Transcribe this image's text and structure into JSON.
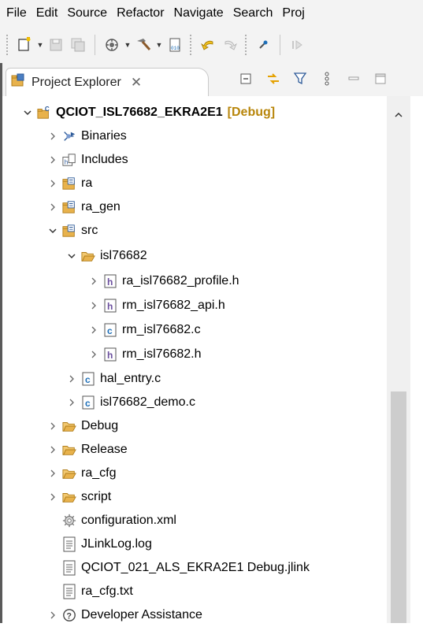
{
  "menubar": {
    "items": [
      "File",
      "Edit",
      "Source",
      "Refactor",
      "Navigate",
      "Search",
      "Proj"
    ]
  },
  "toolbar": {
    "buttons": [
      "new-wizard-icon",
      "save-icon",
      "save-all-icon",
      "debug-config-icon",
      "build-hammer-icon",
      "binary-file-icon",
      "back-arrow-icon",
      "forward-arrow-icon",
      "pin-icon",
      "resume-icon"
    ]
  },
  "view": {
    "title": "Project Explorer",
    "close_glyph": "✕",
    "actions": [
      "collapse-all-icon",
      "link-with-editor-icon",
      "filter-icon",
      "view-menu-icon",
      "minimize-icon",
      "maximize-icon"
    ]
  },
  "tree": {
    "project": {
      "name": "QCIOT_ISL76682_EKRA2E1",
      "config": "[Debug]"
    },
    "items": [
      {
        "label": "Binaries"
      },
      {
        "label": "Includes"
      },
      {
        "label": "ra"
      },
      {
        "label": "ra_gen"
      },
      {
        "label": "src"
      },
      {
        "label": "isl76682"
      },
      {
        "label": "ra_isl76682_profile.h"
      },
      {
        "label": "rm_isl76682_api.h"
      },
      {
        "label": "rm_isl76682.c"
      },
      {
        "label": "rm_isl76682.h"
      },
      {
        "label": "hal_entry.c"
      },
      {
        "label": "isl76682_demo.c"
      },
      {
        "label": "Debug"
      },
      {
        "label": "Release"
      },
      {
        "label": "ra_cfg"
      },
      {
        "label": "script"
      },
      {
        "label": "configuration.xml"
      },
      {
        "label": "JLinkLog.log"
      },
      {
        "label": "QCIOT_021_ALS_EKRA2E1 Debug.jlink"
      },
      {
        "label": "ra_cfg.txt"
      },
      {
        "label": "Developer Assistance"
      }
    ]
  },
  "colors": {
    "debug_config": "#b8860b",
    "folder": "#e8b24c",
    "source_c": "#1e6fb8",
    "header_h": "#6b4f9e"
  }
}
